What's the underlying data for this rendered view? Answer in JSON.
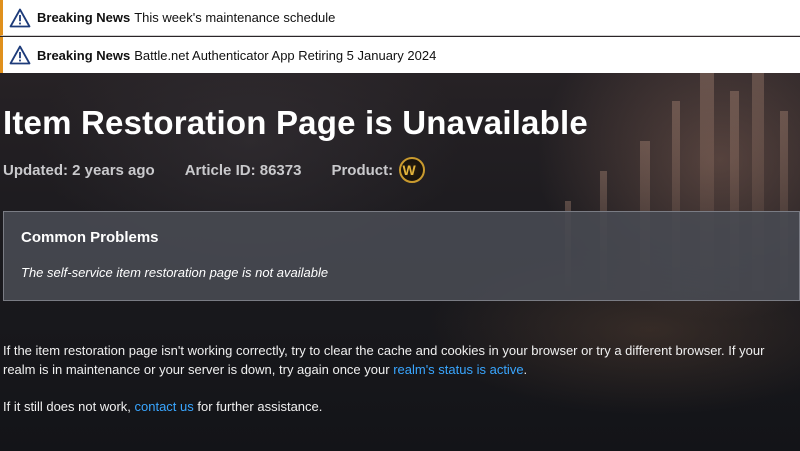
{
  "news": [
    {
      "label": "Breaking News",
      "text": "This week's maintenance schedule"
    },
    {
      "label": "Breaking News",
      "text": "Battle.net Authenticator App Retiring 5 January 2024"
    }
  ],
  "article": {
    "title": "Item Restoration Page is Unavailable",
    "updated": "Updated: 2 years ago",
    "article_id": "Article ID: 86373",
    "product_label": "Product:",
    "product_icon": "world-of-warcraft-logo",
    "product_glyph": "W"
  },
  "common_problems": {
    "heading": "Common Problems",
    "item": "The self-service item restoration page is not available"
  },
  "content": {
    "p1_before": "If the item restoration page isn't working correctly, try to clear the cache and cookies in your browser or try a different browser. If your realm is in maintenance or your server is down, try again once your ",
    "p1_link": "realm's status is active",
    "p1_after": ".",
    "p2_before": "If it still does not work, ",
    "p2_link": "contact us",
    "p2_after": " for further assistance."
  },
  "colors": {
    "accent_orange": "#e0901c",
    "link_blue": "#39a6ff",
    "panel": "#484a52",
    "warning_icon": "#1d3b7a",
    "wow_gold": "#c99a2e"
  }
}
